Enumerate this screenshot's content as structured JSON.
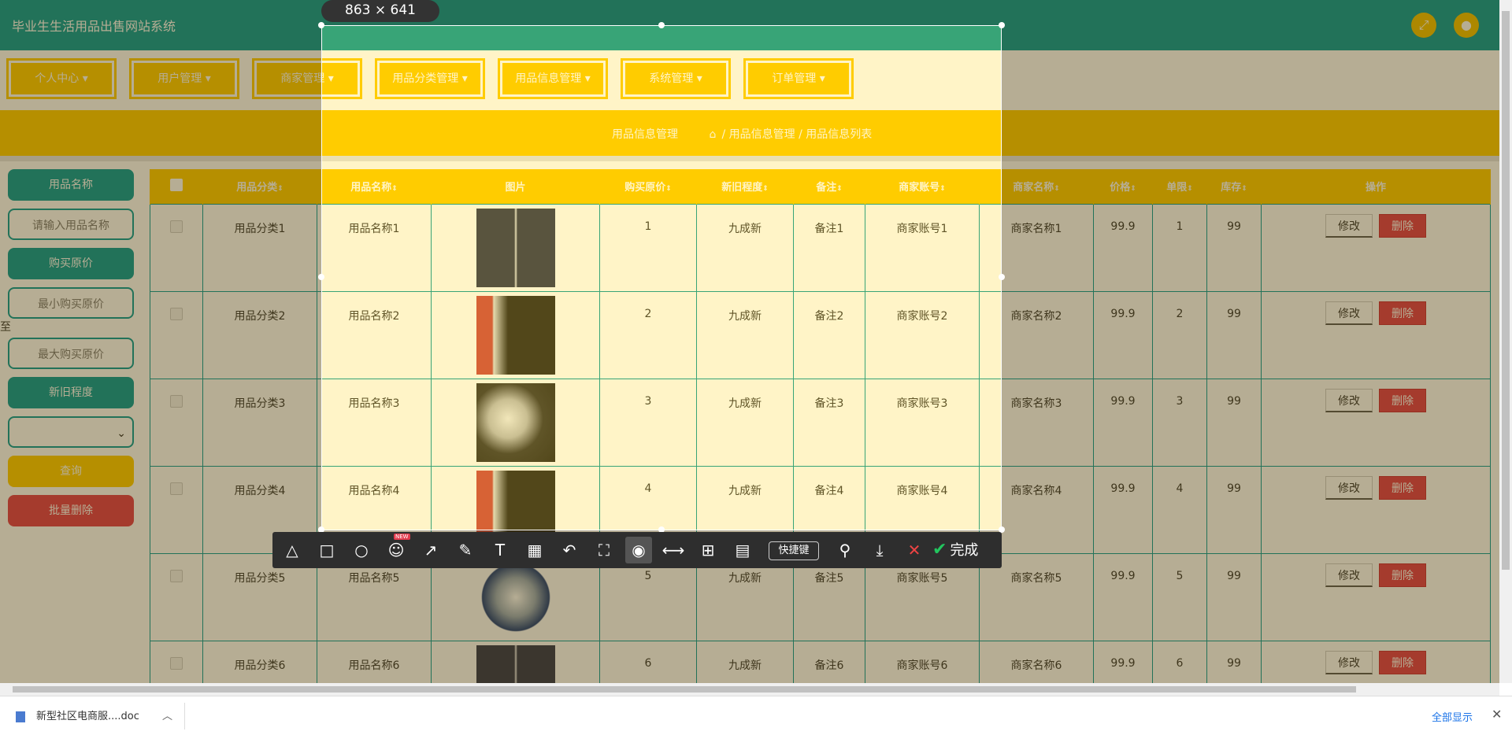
{
  "app": {
    "title": "毕业生生活用品出售网站系统"
  },
  "nav": {
    "items": [
      "个人中心",
      "用户管理",
      "商家管理",
      "用品分类管理",
      "用品信息管理",
      "系统管理",
      "订单管理"
    ],
    "caret": "▾"
  },
  "breadcrumb": {
    "title": "用品信息管理",
    "path": "/ 用品信息管理 / 用品信息列表"
  },
  "sidebar": {
    "name_label": "用品名称",
    "name_placeholder": "请输入用品名称",
    "price_label": "购买原价",
    "min_price_placeholder": "最小购买原价",
    "to_label": "至",
    "max_price_placeholder": "最大购买原价",
    "condition_label": "新旧程度",
    "search_button": "查询",
    "batch_delete_button": "批量删除"
  },
  "table": {
    "headers": [
      "用品分类",
      "用品名称",
      "图片",
      "购买原价",
      "新旧程度",
      "备注",
      "商家账号",
      "商家名称",
      "价格",
      "单限",
      "库存",
      "操作"
    ],
    "sort_icon": "⇕",
    "edit_label": "修改",
    "delete_label": "删除",
    "rows": [
      {
        "category": "用品分类1",
        "name": "用品名称1",
        "orig_price": "1",
        "condition": "九成新",
        "remark": "备注1",
        "account": "商家账号1",
        "merchant": "商家名称1",
        "price": "99.9",
        "limit": "1",
        "stock": "99"
      },
      {
        "category": "用品分类2",
        "name": "用品名称2",
        "orig_price": "2",
        "condition": "九成新",
        "remark": "备注2",
        "account": "商家账号2",
        "merchant": "商家名称2",
        "price": "99.9",
        "limit": "2",
        "stock": "99"
      },
      {
        "category": "用品分类3",
        "name": "用品名称3",
        "orig_price": "3",
        "condition": "九成新",
        "remark": "备注3",
        "account": "商家账号3",
        "merchant": "商家名称3",
        "price": "99.9",
        "limit": "3",
        "stock": "99"
      },
      {
        "category": "用品分类4",
        "name": "用品名称4",
        "orig_price": "4",
        "condition": "九成新",
        "remark": "备注4",
        "account": "商家账号4",
        "merchant": "商家名称4",
        "price": "99.9",
        "limit": "4",
        "stock": "99"
      },
      {
        "category": "用品分类5",
        "name": "用品名称5",
        "orig_price": "5",
        "condition": "九成新",
        "remark": "备注5",
        "account": "商家账号5",
        "merchant": "商家名称5",
        "price": "99.9",
        "limit": "5",
        "stock": "99"
      },
      {
        "category": "用品分类6",
        "name": "用品名称6",
        "orig_price": "6",
        "condition": "九成新",
        "remark": "备注6",
        "account": "商家账号6",
        "merchant": "商家名称6",
        "price": "99.9",
        "limit": "6",
        "stock": "99"
      }
    ]
  },
  "snip": {
    "size_label": "863 × 641",
    "new_badge": "NEW",
    "shortcut_label": "快捷键",
    "done_label": "完成"
  },
  "downloads": {
    "file_name": "新型社区电商服....doc",
    "show_all": "全部显示"
  },
  "colors": {
    "teal": "#009999",
    "yellow": "#ffcc00",
    "red": "#e23b4e"
  }
}
